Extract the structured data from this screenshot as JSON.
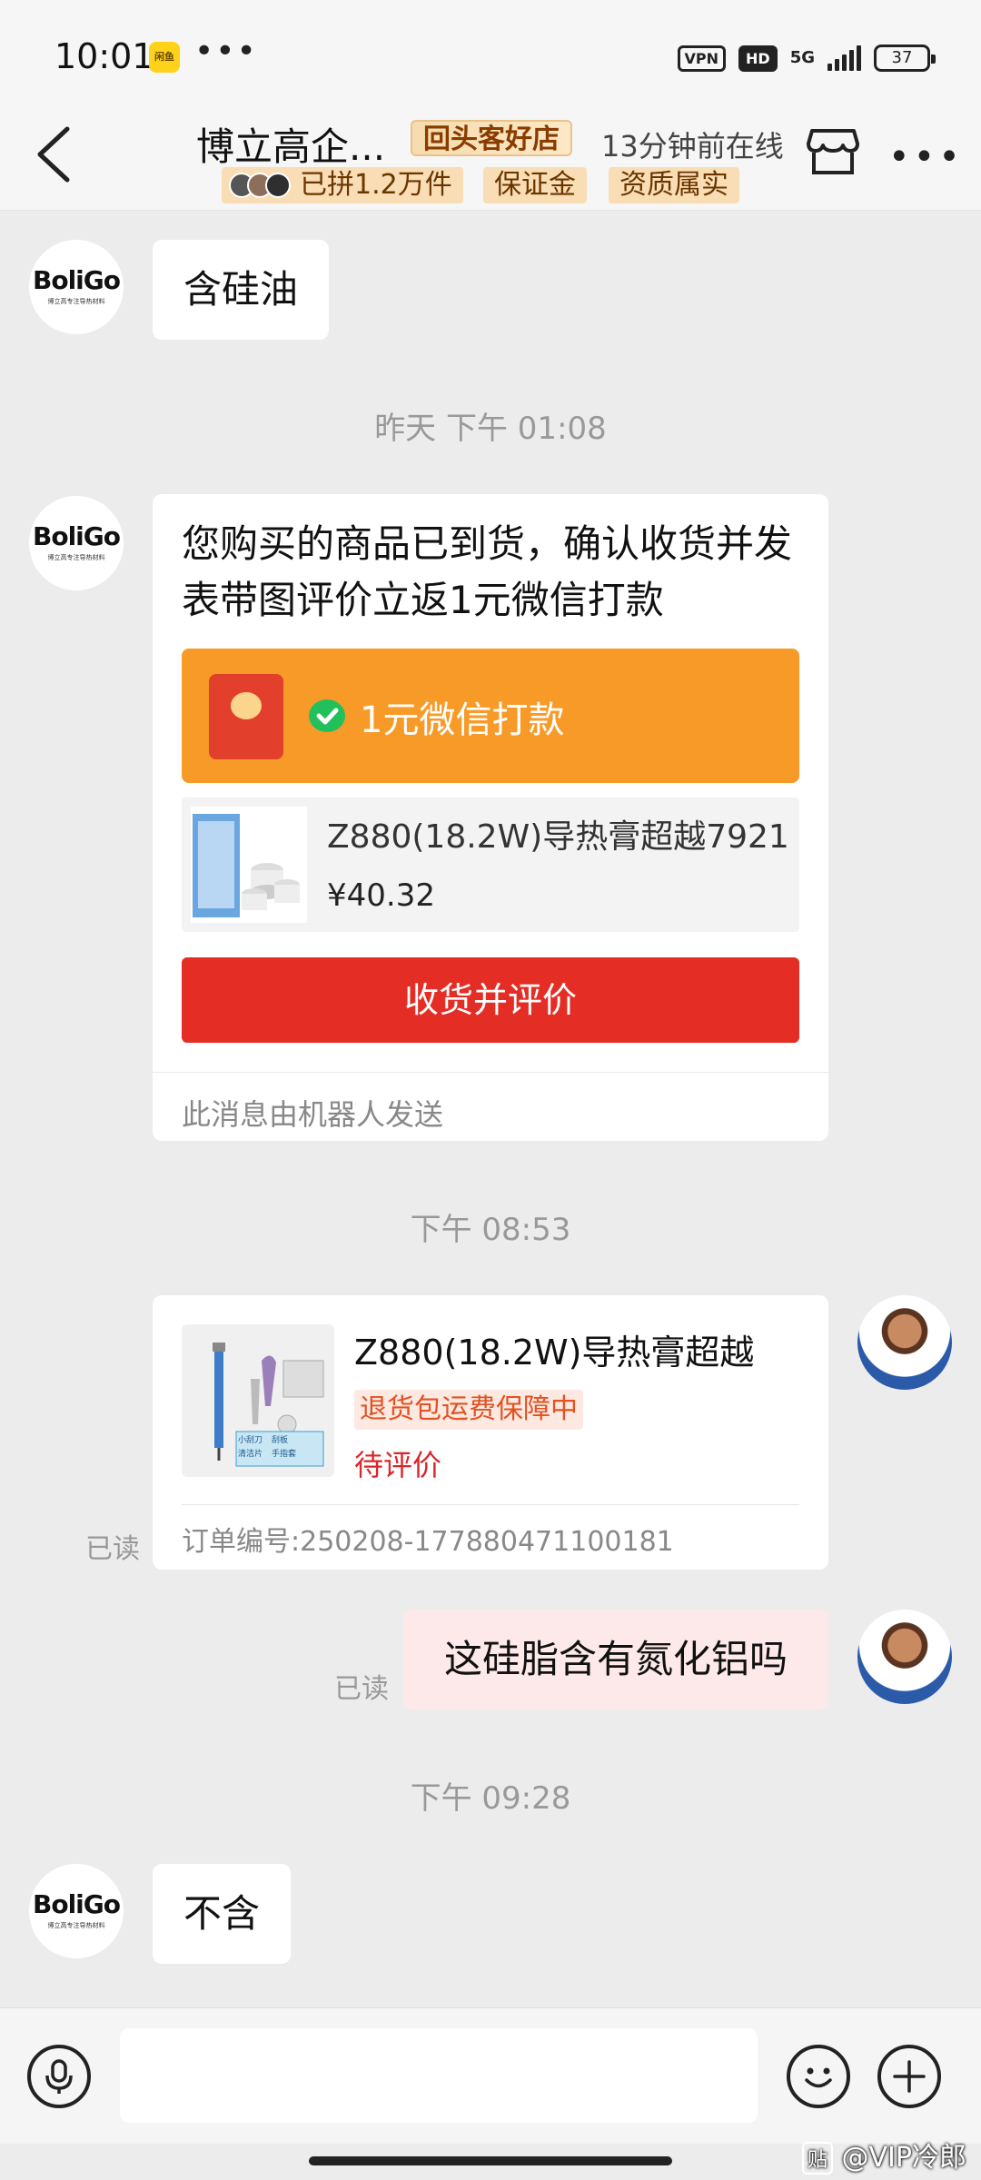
{
  "status_bar": {
    "time": "10:01",
    "app_badge": "闲鱼",
    "dots": "•••",
    "vpn": "VPN",
    "hd": "HD",
    "network": "5G",
    "battery": "37"
  },
  "header": {
    "shop_name": "博立高企...",
    "repeat_badge": "回头客好店",
    "online_status": "13分钟前在线",
    "tags": {
      "sold": "已拼1.2万件",
      "deposit": "保证金",
      "qualification": "资质属实"
    }
  },
  "avatar_logo": {
    "brand": "BoliGo",
    "tagline": "博立高专注导热材料"
  },
  "messages": {
    "m1": "含硅油",
    "ts1": "昨天 下午 01:08",
    "card": {
      "text": "您购买的商品已到货，确认收货并发表带图评价立返1元微信打款",
      "redpack_text": "1元微信打款",
      "product_name": "Z880(18.2W)导热膏超越7921",
      "product_price": "¥40.32",
      "button": "收货并评价",
      "footer": "此消息由机器人发送"
    },
    "ts2": "下午 08:53",
    "order": {
      "name": "Z880(18.2W)导热膏超越",
      "badge": "退货包运费保障中",
      "status": "待评价",
      "number": "订单编号:250208-177880471100181",
      "thumb_labels": [
        "小刮刀",
        "刮板",
        "清洁片",
        "手指套"
      ]
    },
    "read1": "已读",
    "m2": "这硅脂含有氮化铝吗",
    "read2": "已读",
    "ts3": "下午 09:28",
    "m3": "不含"
  },
  "footer": {
    "watermark": "@VIP冷郎",
    "watermark_icon": "贴"
  },
  "colors": {
    "accent_orange": "#f89a28",
    "button_red": "#e42d24",
    "status_red": "#d9272b"
  }
}
